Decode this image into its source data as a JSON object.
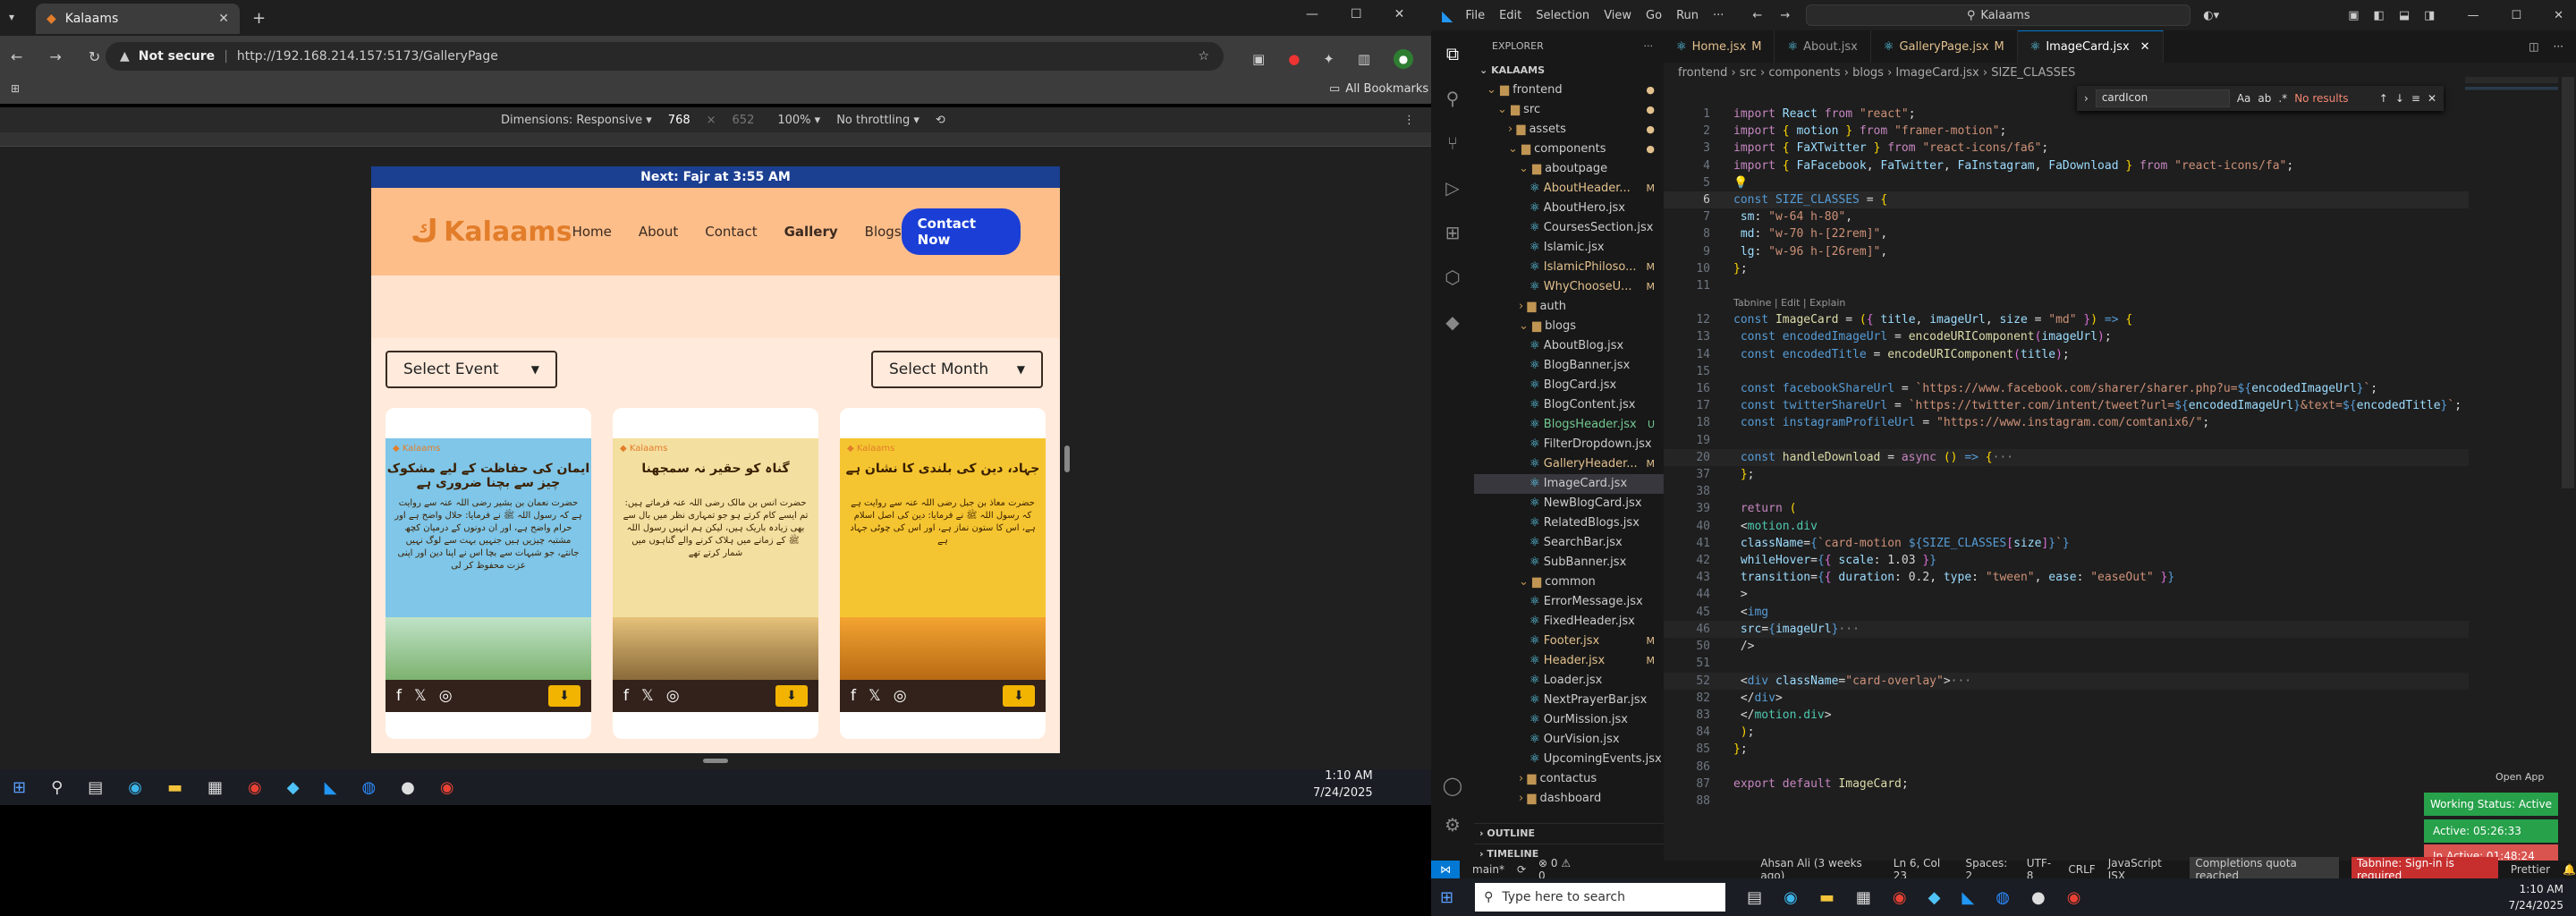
{
  "browser": {
    "tab_title": "Kalaams",
    "security_label": "Not secure",
    "url": "http://192.168.214.157:5173/GalleryPage",
    "bookmarks_label": "All Bookmarks",
    "devtools": {
      "dimensions": "Dimensions: Responsive ▾",
      "width": "768",
      "height": "652",
      "zoom": "100% ▾",
      "throttle": "No throttling ▾"
    }
  },
  "site": {
    "topbar": "Next: Fajr at 3:55 AM",
    "logo": "Kalaams",
    "nav": [
      "Home",
      "About",
      "Contact",
      "Gallery",
      "Blogs"
    ],
    "cta": "Contact Now",
    "filter_event": "Select Event",
    "filter_month": "Select Month",
    "cards": [
      {
        "title": "ایمان کی حفاظت کے لیے مشکوک چیز سے بچنا ضروری ہے",
        "body": "حضرت نعمان بن بشیر رضی اللہ عنہ سے روایت ہے کہ رسول اللہ ﷺ نے فرمایا: حلال واضح ہے اور حرام واضح ہے، اور ان دونوں کے درمیان کچھ مشتبہ چیزیں ہیں جنہیں بہت سے لوگ نہیں جانتے، جو شبہات سے بچا اس نے اپنا دین اور اپنی عزت محفوظ کر لی",
        "bg": "#7fc6e8"
      },
      {
        "title": "گناہ کو حقیر نہ سمجھنا",
        "body": "حضرت انس بن مالک رضی اللہ عنہ فرماتے ہیں: تم ایسے کام کرتے ہو جو تمہاری نظر میں بال سے بھی زیادہ باریک ہیں، لیکن ہم انہیں رسول اللہ ﷺ کے زمانے میں ہلاک کرنے والے گناہوں میں شمار کرتے تھے",
        "bg": "#f3dfa0"
      },
      {
        "title": "جہاد، دین کی بلندی کا نشان ہے",
        "body": "حضرت معاذ بن جبل رضی اللہ عنہ سے روایت ہے کہ رسول اللہ ﷺ نے فرمایا: دین کی اصل اسلام ہے، اس کا ستون نماز ہے، اور اس کی چوٹی جہاد ہے",
        "bg": "#f5c531"
      }
    ]
  },
  "left_clock": {
    "time": "1:10 AM",
    "date": "7/24/2025"
  },
  "vscode": {
    "menu": [
      "File",
      "Edit",
      "Selection",
      "View",
      "Go",
      "Run",
      "···"
    ],
    "search": "Kalaams",
    "explorer_title": "EXPLORER",
    "root": "KALAAMS",
    "tree": [
      {
        "d": 0,
        "n": "frontend",
        "folder": true,
        "open": true
      },
      {
        "d": 1,
        "n": "src",
        "folder": true,
        "open": true
      },
      {
        "d": 2,
        "n": "assets",
        "folder": true,
        "open": false
      },
      {
        "d": 2,
        "n": "components",
        "folder": true,
        "open": true
      },
      {
        "d": 3,
        "n": "aboutpage",
        "folder": true,
        "open": true
      },
      {
        "d": 4,
        "n": "AboutHeader...",
        "s": "M"
      },
      {
        "d": 4,
        "n": "AboutHero.jsx"
      },
      {
        "d": 4,
        "n": "CoursesSection.jsx"
      },
      {
        "d": 4,
        "n": "Islamic.jsx"
      },
      {
        "d": 4,
        "n": "IslamicPhiloso...",
        "s": "M"
      },
      {
        "d": 4,
        "n": "WhyChooseU...",
        "s": "M"
      },
      {
        "d": 3,
        "n": "auth",
        "folder": true,
        "open": false
      },
      {
        "d": 3,
        "n": "blogs",
        "folder": true,
        "open": true
      },
      {
        "d": 4,
        "n": "AboutBlog.jsx"
      },
      {
        "d": 4,
        "n": "BlogBanner.jsx"
      },
      {
        "d": 4,
        "n": "BlogCard.jsx"
      },
      {
        "d": 4,
        "n": "BlogContent.jsx"
      },
      {
        "d": 4,
        "n": "BlogsHeader.jsx",
        "s": "U"
      },
      {
        "d": 4,
        "n": "FilterDropdown.jsx"
      },
      {
        "d": 4,
        "n": "GalleryHeader...",
        "s": "M"
      },
      {
        "d": 4,
        "n": "ImageCard.jsx",
        "sel": true
      },
      {
        "d": 4,
        "n": "NewBlogCard.jsx"
      },
      {
        "d": 4,
        "n": "RelatedBlogs.jsx"
      },
      {
        "d": 4,
        "n": "SearchBar.jsx"
      },
      {
        "d": 4,
        "n": "SubBanner.jsx"
      },
      {
        "d": 3,
        "n": "common",
        "folder": true,
        "open": true
      },
      {
        "d": 4,
        "n": "ErrorMessage.jsx"
      },
      {
        "d": 4,
        "n": "FixedHeader.jsx"
      },
      {
        "d": 4,
        "n": "Footer.jsx",
        "s": "M"
      },
      {
        "d": 4,
        "n": "Header.jsx",
        "s": "M"
      },
      {
        "d": 4,
        "n": "Loader.jsx"
      },
      {
        "d": 4,
        "n": "NextPrayerBar.jsx"
      },
      {
        "d": 4,
        "n": "OurMission.jsx"
      },
      {
        "d": 4,
        "n": "OurVision.jsx"
      },
      {
        "d": 4,
        "n": "UpcomingEvents.jsx"
      },
      {
        "d": 3,
        "n": "contactus",
        "folder": true,
        "open": false
      },
      {
        "d": 3,
        "n": "dashboard",
        "folder": true,
        "open": false
      }
    ],
    "outline": "OUTLINE",
    "timeline": "TIMELINE",
    "tabs": [
      {
        "n": "Home.jsx",
        "s": "M"
      },
      {
        "n": "About.jsx",
        "s": ""
      },
      {
        "n": "GalleryPage.jsx",
        "s": "M"
      },
      {
        "n": "ImageCard.jsx",
        "s": "",
        "active": true
      }
    ],
    "breadcrumb": "frontend › src › components › blogs › ImageCard.jsx › SIZE_CLASSES",
    "find_text": "cardIcon",
    "find_result": "No results",
    "codelens": "Tabnine | Edit | Explain",
    "status": {
      "branch": "main*",
      "errors": "⊗ 0 ⚠ 0",
      "blame": "Ahsan Ali (3 weeks ago)",
      "pos": "Ln 6, Col 23",
      "spaces": "Spaces: 2",
      "enc": "UTF-8",
      "eol": "CRLF",
      "lang": "JavaScript JSX",
      "quota": "Completions quota reached",
      "tabnine": "Tabnine: Sign-in is required",
      "prettier": "Prettier"
    },
    "openapp": "Open App",
    "working": "Working Status: Active",
    "active": "Active: 05:26:33",
    "inactive": "In Active: 01:48:24"
  },
  "right_taskbar": {
    "search": "Type here to search",
    "time": "1:10 AM",
    "date": "7/24/2025"
  }
}
